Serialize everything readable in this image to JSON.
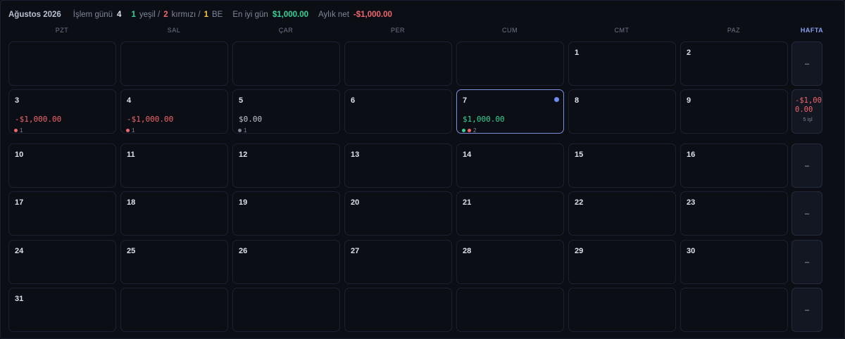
{
  "summary": {
    "month": "Ağustos 2026",
    "trading_days_label": "İşlem günü",
    "trading_days": "4",
    "green_count": "1",
    "green_label": "yeşil /",
    "red_count": "2",
    "red_label": "kırmızı /",
    "be_count": "1",
    "be_label": "BE",
    "best_day_label": "En iyi gün",
    "best_day_value": "$1,000.00",
    "monthly_net_label": "Aylık net",
    "monthly_net_value": "-$1,000.00"
  },
  "weekdays": [
    "PZT",
    "SAL",
    "ÇAR",
    "PER",
    "CUM",
    "CMT",
    "PAZ"
  ],
  "week_header": "HAFTA",
  "days": {
    "d1": "1",
    "d2": "2",
    "d3": "3",
    "d4": "4",
    "d5": "5",
    "d6": "6",
    "d7": "7",
    "d8": "8",
    "d9": "9",
    "d10": "10",
    "d11": "11",
    "d12": "12",
    "d13": "13",
    "d14": "14",
    "d15": "15",
    "d16": "16",
    "d17": "17",
    "d18": "18",
    "d19": "19",
    "d20": "20",
    "d21": "21",
    "d22": "22",
    "d23": "23",
    "d24": "24",
    "d25": "25",
    "d26": "26",
    "d27": "27",
    "d28": "28",
    "d29": "29",
    "d30": "30",
    "d31": "31"
  },
  "day_pnl": {
    "d3": {
      "value": "-$1,000.00",
      "trades": "1"
    },
    "d4": {
      "value": "-$1,000.00",
      "trades": "1"
    },
    "d5": {
      "value": "$0.00",
      "trades": "1"
    },
    "d7": {
      "value": "$1,000.00",
      "trades": "2"
    }
  },
  "weeks": {
    "w1": "–",
    "w2": {
      "value": "-$1,000.00",
      "count": "5 işl"
    },
    "w3": "–",
    "w4": "–",
    "w5": "–",
    "w6": "–"
  },
  "colors": {
    "positive": "#34d399",
    "negative": "#f1666d",
    "breakeven": "#f5c542",
    "accent": "#7f8fe0"
  }
}
